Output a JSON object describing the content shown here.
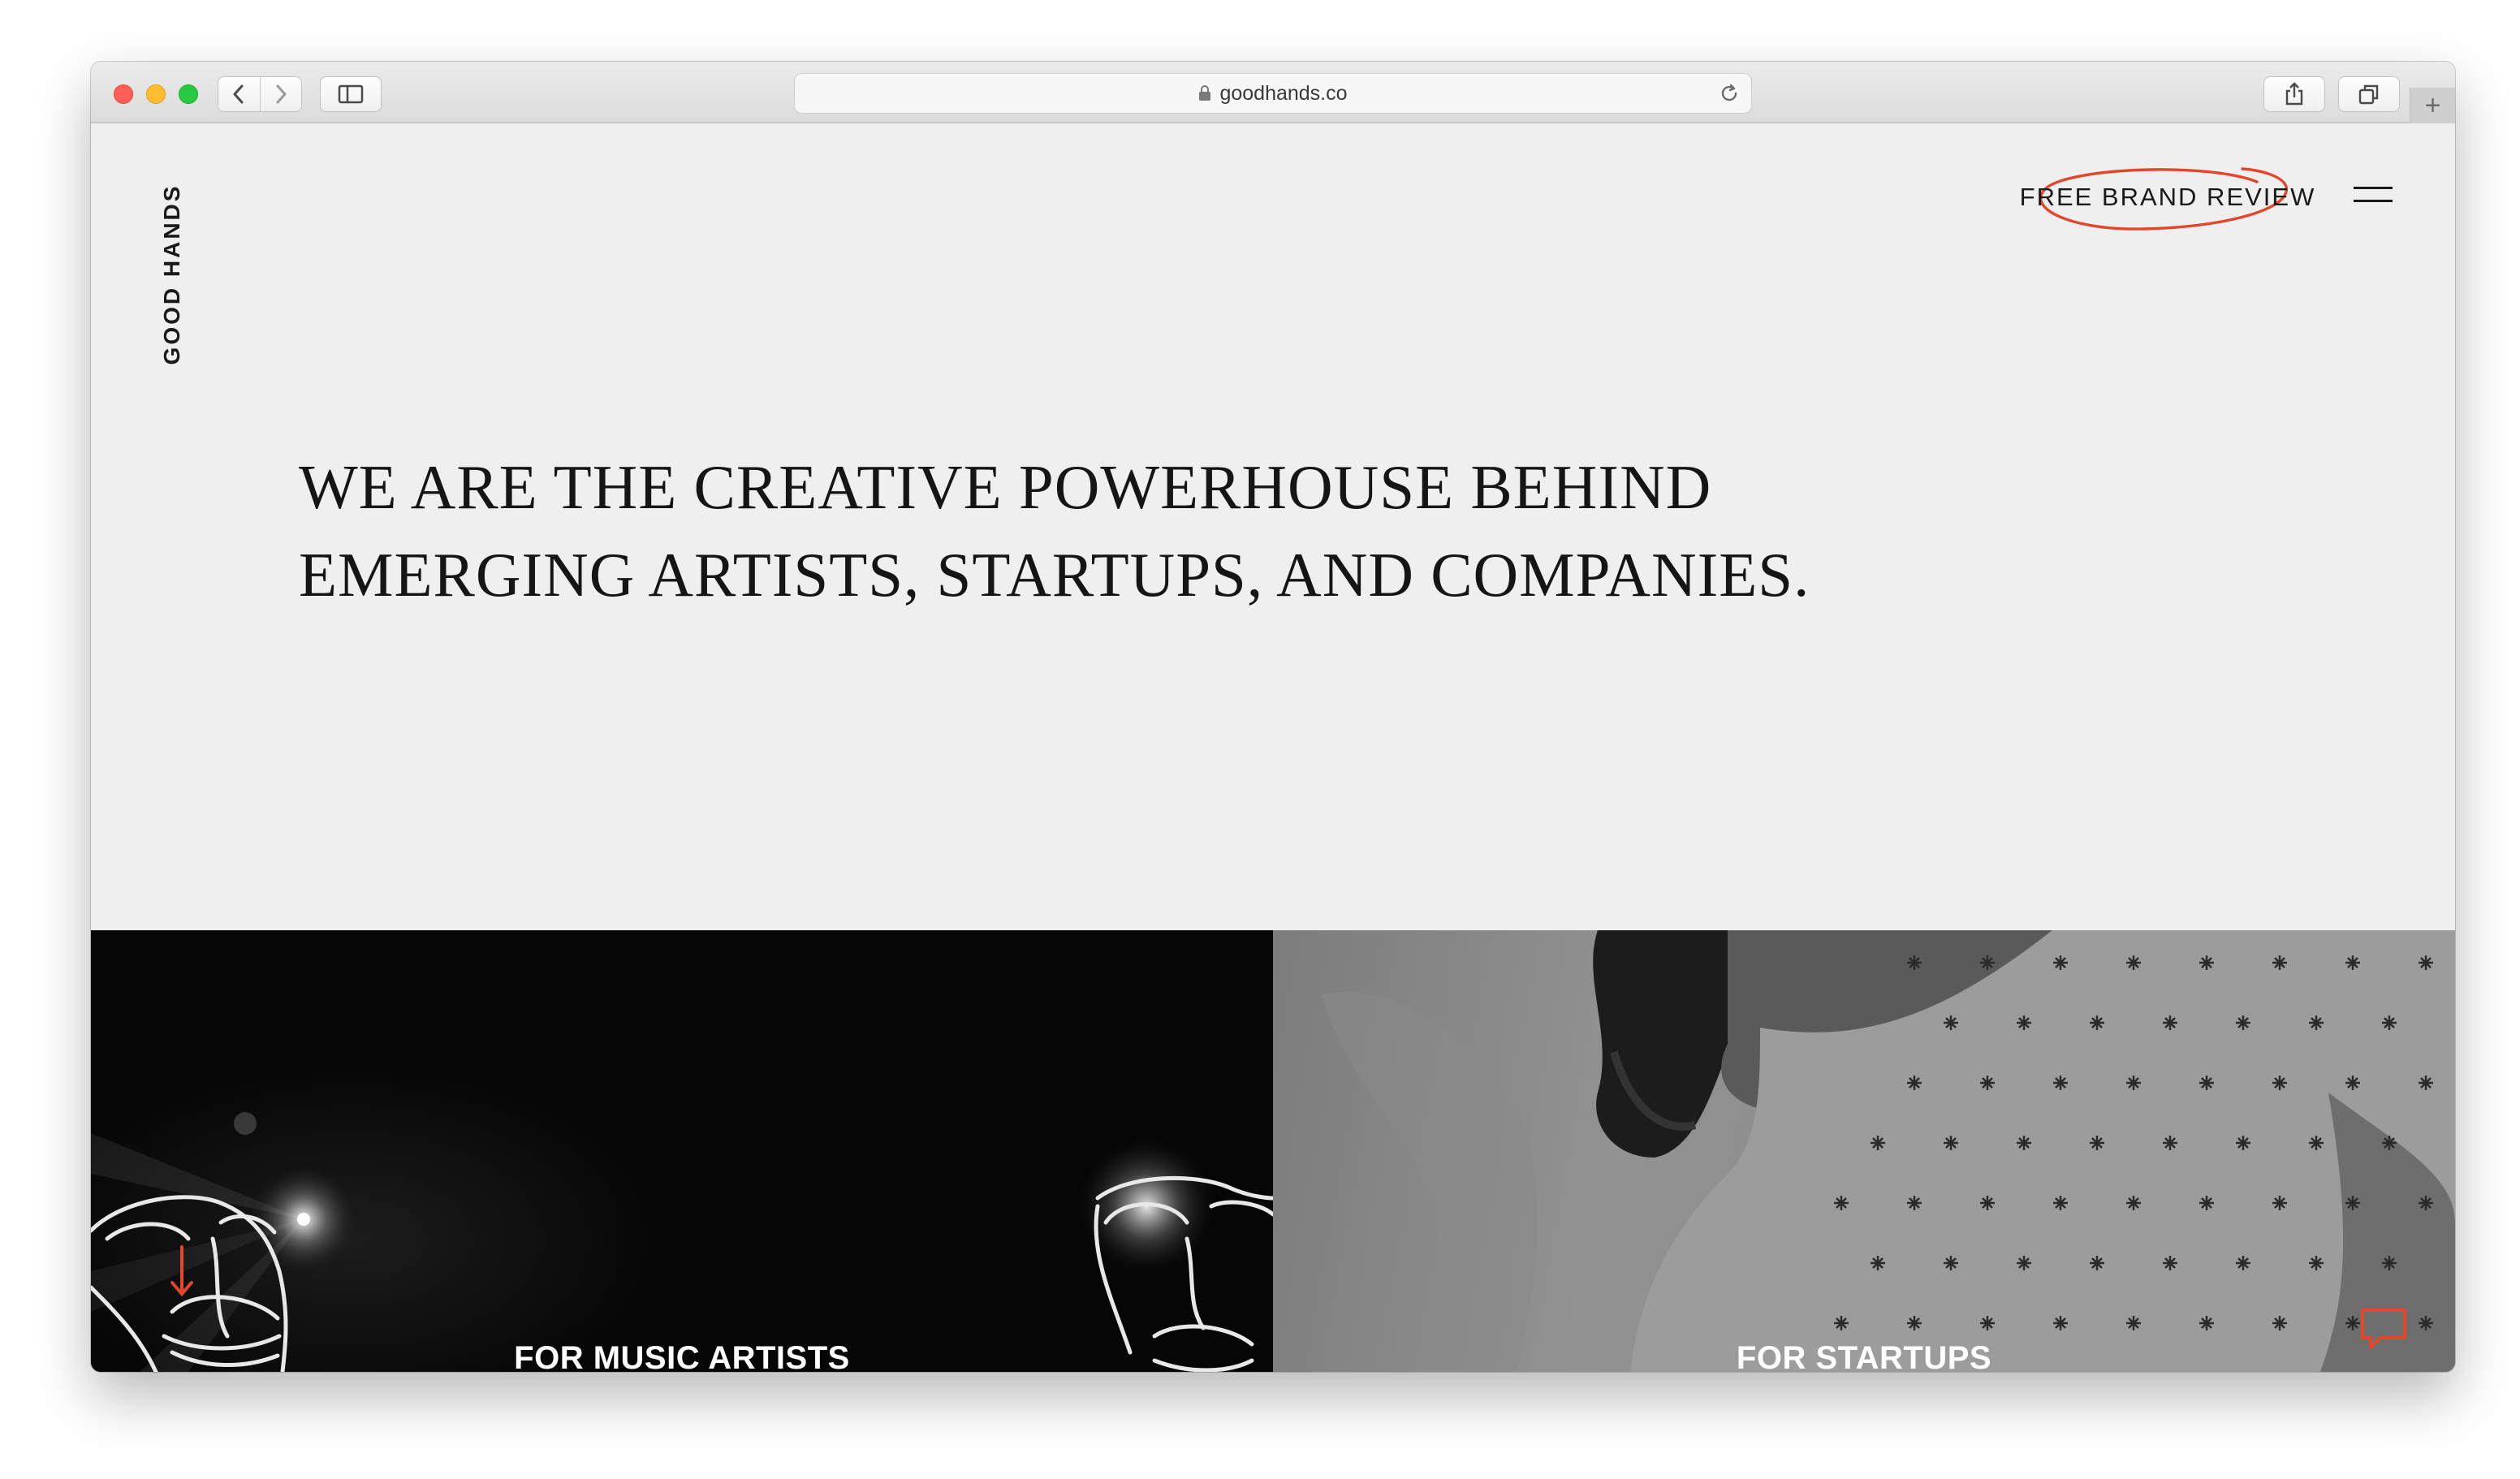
{
  "browser": {
    "url": "goodhands.co",
    "new_tab_symbol": "+"
  },
  "site": {
    "brand": "GOOD HANDS",
    "cta_label": "FREE BRAND REVIEW",
    "headline_line1": "WE ARE THE CREATIVE POWERHOUSE BEHIND",
    "headline_line2": "EMERGING ARTISTS, STARTUPS, AND COMPANIES."
  },
  "tiles": [
    {
      "label": "FOR MUSIC ARTISTS"
    },
    {
      "label": "FOR STARTUPS"
    }
  ],
  "colors": {
    "accent": "#e2462b",
    "page_bg": "#efefef",
    "text": "#151515"
  },
  "icons": {
    "back": "chevron-left-icon",
    "forward": "chevron-right-icon",
    "sidebar": "sidebar-icon",
    "lock": "lock-icon",
    "reload": "reload-icon",
    "share": "share-icon",
    "tabs": "tabs-overview-icon",
    "menu": "hamburger-menu-icon",
    "chat": "chat-bubble-icon"
  }
}
